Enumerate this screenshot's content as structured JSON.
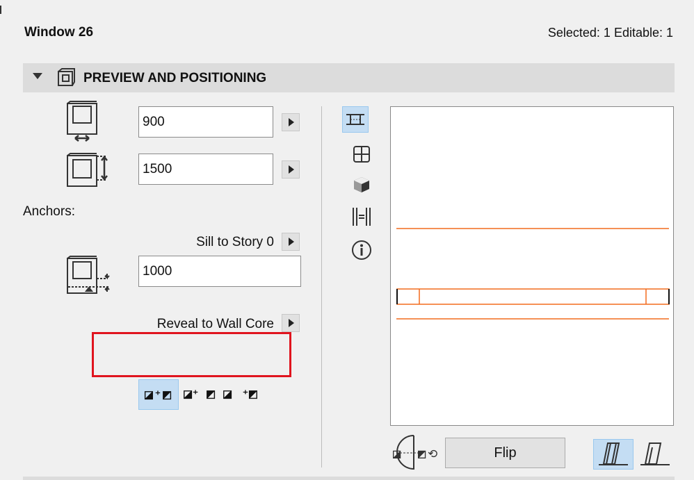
{
  "panel": {
    "title": "Window 26",
    "selection": "Selected: 1 Editable: 1"
  },
  "section": {
    "label": "PREVIEW AND POSITIONING"
  },
  "width": {
    "value": "900"
  },
  "height": {
    "value": "1500"
  },
  "anchors": {
    "label": "Anchors:",
    "sill_label": "Sill to Story 0",
    "sill_value": "1000",
    "reveal_label": "Reveal to Wall Core"
  },
  "flip": {
    "label": "Flip"
  },
  "colors": {
    "accent": "#c4ddf3",
    "preview_line": "#f26b1d",
    "highlight": "#e0141e"
  }
}
